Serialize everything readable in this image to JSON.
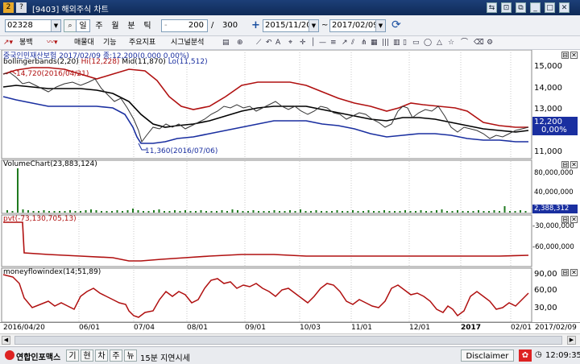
{
  "window": {
    "title": "[9403] 해외주식 차트",
    "code_badge": "2",
    "help_badge": "?"
  },
  "toolbar": {
    "symbol": "02328",
    "period_tabs": [
      "일",
      "주",
      "월",
      "분",
      "틱"
    ],
    "count_value": "200",
    "count_total": "300",
    "date_from": "2015/11/20",
    "date_to": "2017/02/09",
    "range_sep": "~"
  },
  "toolbar2": {
    "items": [
      "봉백",
      "매물대",
      "기능",
      "주요지표",
      "시그널분석"
    ]
  },
  "price_panel": {
    "header": "중국인민재산보험  2017/02/09 종:12,200(0,000 0,00%)",
    "bb_label": "bollingerbands(2,20)",
    "bb_hi": "Hi(12,228)",
    "bb_mid": "Mid(11,870)",
    "bb_lo": "Lo(11,512)",
    "high_mark": "14,720(2016/04/21)",
    "low_mark": "11,360(2016/07/06)",
    "axis": [
      "15,000",
      "14,000",
      "13,000",
      "12,000",
      "11,000"
    ],
    "last_price": "12,200",
    "last_change": "0,00%"
  },
  "volume_panel": {
    "label": "VolumeChart(23,883,124)",
    "axis": [
      "80,000,000",
      "40,000,000"
    ],
    "last": "2,388,312"
  },
  "pvt_panel": {
    "label": "pvt(-73,130,705,13)",
    "axis": [
      "-30,000,000",
      "-60,000,000"
    ]
  },
  "mfi_panel": {
    "label": "moneyflowindex(14;51,89)",
    "axis": [
      "90,00",
      "60,00",
      "30,00"
    ]
  },
  "xaxis": [
    "2016/04/20",
    "06/01",
    "07/04",
    "08/01",
    "09/01",
    "10/03",
    "11/01",
    "12/01",
    "2017",
    "02/01",
    "2017/02/09"
  ],
  "status": {
    "brand": "연합인포맥스",
    "tabs": [
      "기",
      "현",
      "차",
      "주",
      "뉴"
    ],
    "delay": "15분 지연시세",
    "disclaimer": "Disclaimer",
    "time": "12:09:35"
  },
  "colors": {
    "bb_upper": "#b01010",
    "bb_lower": "#1a2fa0",
    "bb_mid": "#000000",
    "volume": "#1f7a1f",
    "pvt": "#b01010",
    "mfi": "#b01010",
    "title": "#0f2a57"
  }
}
